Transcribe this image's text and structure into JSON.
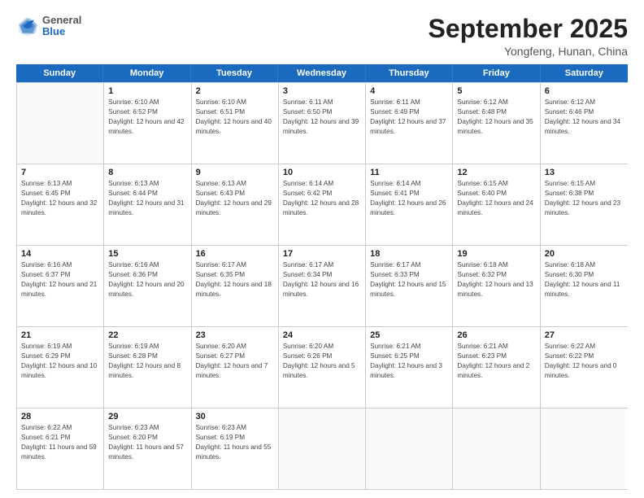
{
  "header": {
    "logo": {
      "general": "General",
      "blue": "Blue"
    },
    "title": "September 2025",
    "location": "Yongfeng, Hunan, China"
  },
  "days": [
    "Sunday",
    "Monday",
    "Tuesday",
    "Wednesday",
    "Thursday",
    "Friday",
    "Saturday"
  ],
  "weeks": [
    [
      {
        "day": "",
        "sunrise": "",
        "sunset": "",
        "daylight": ""
      },
      {
        "day": "1",
        "sunrise": "Sunrise: 6:10 AM",
        "sunset": "Sunset: 6:52 PM",
        "daylight": "Daylight: 12 hours and 42 minutes."
      },
      {
        "day": "2",
        "sunrise": "Sunrise: 6:10 AM",
        "sunset": "Sunset: 6:51 PM",
        "daylight": "Daylight: 12 hours and 40 minutes."
      },
      {
        "day": "3",
        "sunrise": "Sunrise: 6:11 AM",
        "sunset": "Sunset: 6:50 PM",
        "daylight": "Daylight: 12 hours and 39 minutes."
      },
      {
        "day": "4",
        "sunrise": "Sunrise: 6:11 AM",
        "sunset": "Sunset: 6:49 PM",
        "daylight": "Daylight: 12 hours and 37 minutes."
      },
      {
        "day": "5",
        "sunrise": "Sunrise: 6:12 AM",
        "sunset": "Sunset: 6:48 PM",
        "daylight": "Daylight: 12 hours and 35 minutes."
      },
      {
        "day": "6",
        "sunrise": "Sunrise: 6:12 AM",
        "sunset": "Sunset: 6:46 PM",
        "daylight": "Daylight: 12 hours and 34 minutes."
      }
    ],
    [
      {
        "day": "7",
        "sunrise": "Sunrise: 6:13 AM",
        "sunset": "Sunset: 6:45 PM",
        "daylight": "Daylight: 12 hours and 32 minutes."
      },
      {
        "day": "8",
        "sunrise": "Sunrise: 6:13 AM",
        "sunset": "Sunset: 6:44 PM",
        "daylight": "Daylight: 12 hours and 31 minutes."
      },
      {
        "day": "9",
        "sunrise": "Sunrise: 6:13 AM",
        "sunset": "Sunset: 6:43 PM",
        "daylight": "Daylight: 12 hours and 29 minutes."
      },
      {
        "day": "10",
        "sunrise": "Sunrise: 6:14 AM",
        "sunset": "Sunset: 6:42 PM",
        "daylight": "Daylight: 12 hours and 28 minutes."
      },
      {
        "day": "11",
        "sunrise": "Sunrise: 6:14 AM",
        "sunset": "Sunset: 6:41 PM",
        "daylight": "Daylight: 12 hours and 26 minutes."
      },
      {
        "day": "12",
        "sunrise": "Sunrise: 6:15 AM",
        "sunset": "Sunset: 6:40 PM",
        "daylight": "Daylight: 12 hours and 24 minutes."
      },
      {
        "day": "13",
        "sunrise": "Sunrise: 6:15 AM",
        "sunset": "Sunset: 6:38 PM",
        "daylight": "Daylight: 12 hours and 23 minutes."
      }
    ],
    [
      {
        "day": "14",
        "sunrise": "Sunrise: 6:16 AM",
        "sunset": "Sunset: 6:37 PM",
        "daylight": "Daylight: 12 hours and 21 minutes."
      },
      {
        "day": "15",
        "sunrise": "Sunrise: 6:16 AM",
        "sunset": "Sunset: 6:36 PM",
        "daylight": "Daylight: 12 hours and 20 minutes."
      },
      {
        "day": "16",
        "sunrise": "Sunrise: 6:17 AM",
        "sunset": "Sunset: 6:35 PM",
        "daylight": "Daylight: 12 hours and 18 minutes."
      },
      {
        "day": "17",
        "sunrise": "Sunrise: 6:17 AM",
        "sunset": "Sunset: 6:34 PM",
        "daylight": "Daylight: 12 hours and 16 minutes."
      },
      {
        "day": "18",
        "sunrise": "Sunrise: 6:17 AM",
        "sunset": "Sunset: 6:33 PM",
        "daylight": "Daylight: 12 hours and 15 minutes."
      },
      {
        "day": "19",
        "sunrise": "Sunrise: 6:18 AM",
        "sunset": "Sunset: 6:32 PM",
        "daylight": "Daylight: 12 hours and 13 minutes."
      },
      {
        "day": "20",
        "sunrise": "Sunrise: 6:18 AM",
        "sunset": "Sunset: 6:30 PM",
        "daylight": "Daylight: 12 hours and 11 minutes."
      }
    ],
    [
      {
        "day": "21",
        "sunrise": "Sunrise: 6:19 AM",
        "sunset": "Sunset: 6:29 PM",
        "daylight": "Daylight: 12 hours and 10 minutes."
      },
      {
        "day": "22",
        "sunrise": "Sunrise: 6:19 AM",
        "sunset": "Sunset: 6:28 PM",
        "daylight": "Daylight: 12 hours and 8 minutes."
      },
      {
        "day": "23",
        "sunrise": "Sunrise: 6:20 AM",
        "sunset": "Sunset: 6:27 PM",
        "daylight": "Daylight: 12 hours and 7 minutes."
      },
      {
        "day": "24",
        "sunrise": "Sunrise: 6:20 AM",
        "sunset": "Sunset: 6:26 PM",
        "daylight": "Daylight: 12 hours and 5 minutes."
      },
      {
        "day": "25",
        "sunrise": "Sunrise: 6:21 AM",
        "sunset": "Sunset: 6:25 PM",
        "daylight": "Daylight: 12 hours and 3 minutes."
      },
      {
        "day": "26",
        "sunrise": "Sunrise: 6:21 AM",
        "sunset": "Sunset: 6:23 PM",
        "daylight": "Daylight: 12 hours and 2 minutes."
      },
      {
        "day": "27",
        "sunrise": "Sunrise: 6:22 AM",
        "sunset": "Sunset: 6:22 PM",
        "daylight": "Daylight: 12 hours and 0 minutes."
      }
    ],
    [
      {
        "day": "28",
        "sunrise": "Sunrise: 6:22 AM",
        "sunset": "Sunset: 6:21 PM",
        "daylight": "Daylight: 11 hours and 59 minutes."
      },
      {
        "day": "29",
        "sunrise": "Sunrise: 6:23 AM",
        "sunset": "Sunset: 6:20 PM",
        "daylight": "Daylight: 11 hours and 57 minutes."
      },
      {
        "day": "30",
        "sunrise": "Sunrise: 6:23 AM",
        "sunset": "Sunset: 6:19 PM",
        "daylight": "Daylight: 11 hours and 55 minutes."
      },
      {
        "day": "",
        "sunrise": "",
        "sunset": "",
        "daylight": ""
      },
      {
        "day": "",
        "sunrise": "",
        "sunset": "",
        "daylight": ""
      },
      {
        "day": "",
        "sunrise": "",
        "sunset": "",
        "daylight": ""
      },
      {
        "day": "",
        "sunrise": "",
        "sunset": "",
        "daylight": ""
      }
    ]
  ]
}
